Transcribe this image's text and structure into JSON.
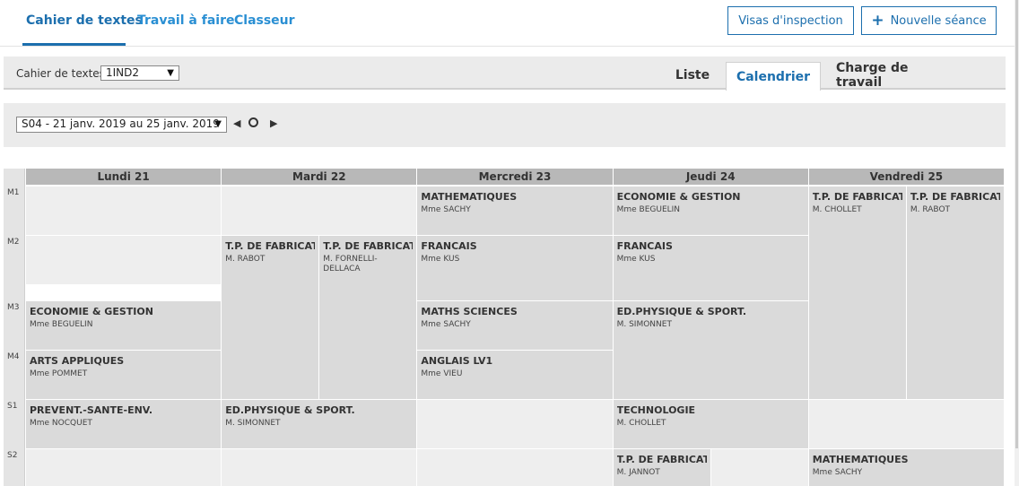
{
  "nav": {
    "tabs": [
      "Cahier de textes",
      "Travail à faire",
      "Classeur"
    ],
    "visas_label": "Visas d'inspection",
    "new_label": "Nouvelle séance",
    "new_icon": "plus-icon"
  },
  "toolbar": {
    "cahier_label": "Cahier de textes",
    "cahier_value": "1IND2",
    "views": [
      "Liste",
      "Calendrier",
      "Charge de travail"
    ],
    "active_view": "Calendrier"
  },
  "week": {
    "value": "S04 - 21 janv. 2019 au 25 janv. 2019"
  },
  "calendar": {
    "days": [
      "Lundi 21",
      "Mardi 22",
      "Mercredi 23",
      "Jeudi 24",
      "Vendredi 25"
    ],
    "slots": [
      "M1",
      "M2",
      "M3",
      "M4",
      "S1",
      "S2"
    ],
    "lessons": [
      {
        "day": 0,
        "sub": 0,
        "of": 1,
        "start": 2,
        "end": 3,
        "subject": "ECONOMIE & GESTION",
        "teacher": "Mme BEGUELIN"
      },
      {
        "day": 0,
        "sub": 0,
        "of": 1,
        "start": 3,
        "end": 4,
        "subject": "ARTS APPLIQUES",
        "teacher": "Mme POMMET"
      },
      {
        "day": 0,
        "sub": 0,
        "of": 1,
        "start": 4,
        "end": 5,
        "subject": "PREVENT.-SANTE-ENV.",
        "teacher": "Mme NOCQUET"
      },
      {
        "day": 1,
        "sub": 0,
        "of": 2,
        "start": 1,
        "end": 4,
        "subject": "T.P. DE FABRICATION",
        "teacher": "M. RABOT"
      },
      {
        "day": 1,
        "sub": 1,
        "of": 2,
        "start": 1,
        "end": 4,
        "subject": "T.P. DE FABRICATION",
        "teacher": "M. FORNELLI-DELLACA"
      },
      {
        "day": 1,
        "sub": 0,
        "of": 1,
        "start": 4,
        "end": 5,
        "subject": "ED.PHYSIQUE & SPORT.",
        "teacher": "M. SIMONNET"
      },
      {
        "day": 2,
        "sub": 0,
        "of": 1,
        "start": 0,
        "end": 1,
        "subject": "MATHEMATIQUES",
        "teacher": "Mme SACHY"
      },
      {
        "day": 2,
        "sub": 0,
        "of": 1,
        "start": 1,
        "end": 2,
        "subject": "FRANCAIS",
        "teacher": "Mme KUS"
      },
      {
        "day": 2,
        "sub": 0,
        "of": 1,
        "start": 2,
        "end": 3,
        "subject": "MATHS SCIENCES",
        "teacher": "Mme SACHY"
      },
      {
        "day": 2,
        "sub": 0,
        "of": 1,
        "start": 3,
        "end": 4,
        "subject": "ANGLAIS LV1",
        "teacher": "Mme VIEU"
      },
      {
        "day": 3,
        "sub": 0,
        "of": 1,
        "start": 0,
        "end": 1,
        "subject": "ECONOMIE & GESTION",
        "teacher": "Mme BEGUELIN"
      },
      {
        "day": 3,
        "sub": 0,
        "of": 1,
        "start": 1,
        "end": 2,
        "subject": "FRANCAIS",
        "teacher": "Mme KUS"
      },
      {
        "day": 3,
        "sub": 0,
        "of": 1,
        "start": 2,
        "end": 4,
        "subject": "ED.PHYSIQUE & SPORT.",
        "teacher": "M. SIMONNET"
      },
      {
        "day": 3,
        "sub": 0,
        "of": 1,
        "start": 4,
        "end": 5,
        "subject": "TECHNOLOGIE",
        "teacher": "M. CHOLLET"
      },
      {
        "day": 3,
        "sub": 0,
        "of": 2,
        "start": 5,
        "end": 6,
        "subject": "T.P. DE FABRICATION",
        "teacher": "M. JANNOT"
      },
      {
        "day": 4,
        "sub": 0,
        "of": 2,
        "start": 0,
        "end": 4,
        "subject": "T.P. DE FABRICATION",
        "teacher": "M. CHOLLET"
      },
      {
        "day": 4,
        "sub": 1,
        "of": 2,
        "start": 0,
        "end": 4,
        "subject": "T.P. DE FABRICATION",
        "teacher": "M. RABOT"
      },
      {
        "day": 4,
        "sub": 0,
        "of": 1,
        "start": 5,
        "end": 6,
        "subject": "MATHEMATIQUES",
        "teacher": "Mme SACHY"
      }
    ]
  }
}
